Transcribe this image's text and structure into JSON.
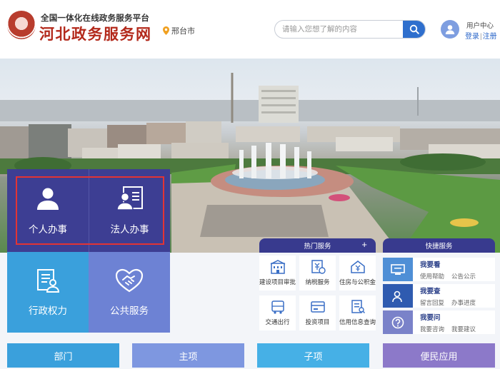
{
  "header": {
    "subtitle": "全国一体化在线政务服务平台",
    "title": "河北政务服务网",
    "location": "邢台市",
    "search": {
      "placeholder": "请输入您想了解的内容"
    },
    "user": {
      "center": "用户中心",
      "login": "登录",
      "separator": "|",
      "register": "注册"
    }
  },
  "tiles": {
    "personal": "个人办事",
    "legal": "法人办事",
    "admin": "行政权力",
    "public": "公共服务"
  },
  "hot": {
    "title": "热门服务",
    "plus": "+",
    "items": [
      {
        "label": "建设项目审批",
        "icon": "building-icon"
      },
      {
        "label": "纳税服务",
        "icon": "tax-icon"
      },
      {
        "label": "住房与公积金",
        "icon": "house-yuan-icon"
      },
      {
        "label": "交通出行",
        "icon": "bus-icon"
      },
      {
        "label": "投资项目",
        "icon": "card-icon"
      },
      {
        "label": "信用信息查询",
        "icon": "document-search-icon"
      }
    ]
  },
  "quick": {
    "title": "快捷服务",
    "rows": [
      {
        "title": "我要看",
        "links": [
          "使用帮助",
          "公告公示"
        ],
        "color": "#4f8fd6"
      },
      {
        "title": "我要查",
        "links": [
          "留言回复",
          "办事进度"
        ],
        "color": "#2f5bb0"
      },
      {
        "title": "我要问",
        "links": [
          "我要咨询",
          "我要建议"
        ],
        "color": "#7a82c9"
      }
    ]
  },
  "nav": [
    {
      "label": "部门",
      "color": "#3aa0dc"
    },
    {
      "label": "主项",
      "color": "#7e97e0"
    },
    {
      "label": "子项",
      "color": "#46b0e6"
    },
    {
      "label": "便民应用",
      "color": "#8c79c9"
    }
  ]
}
